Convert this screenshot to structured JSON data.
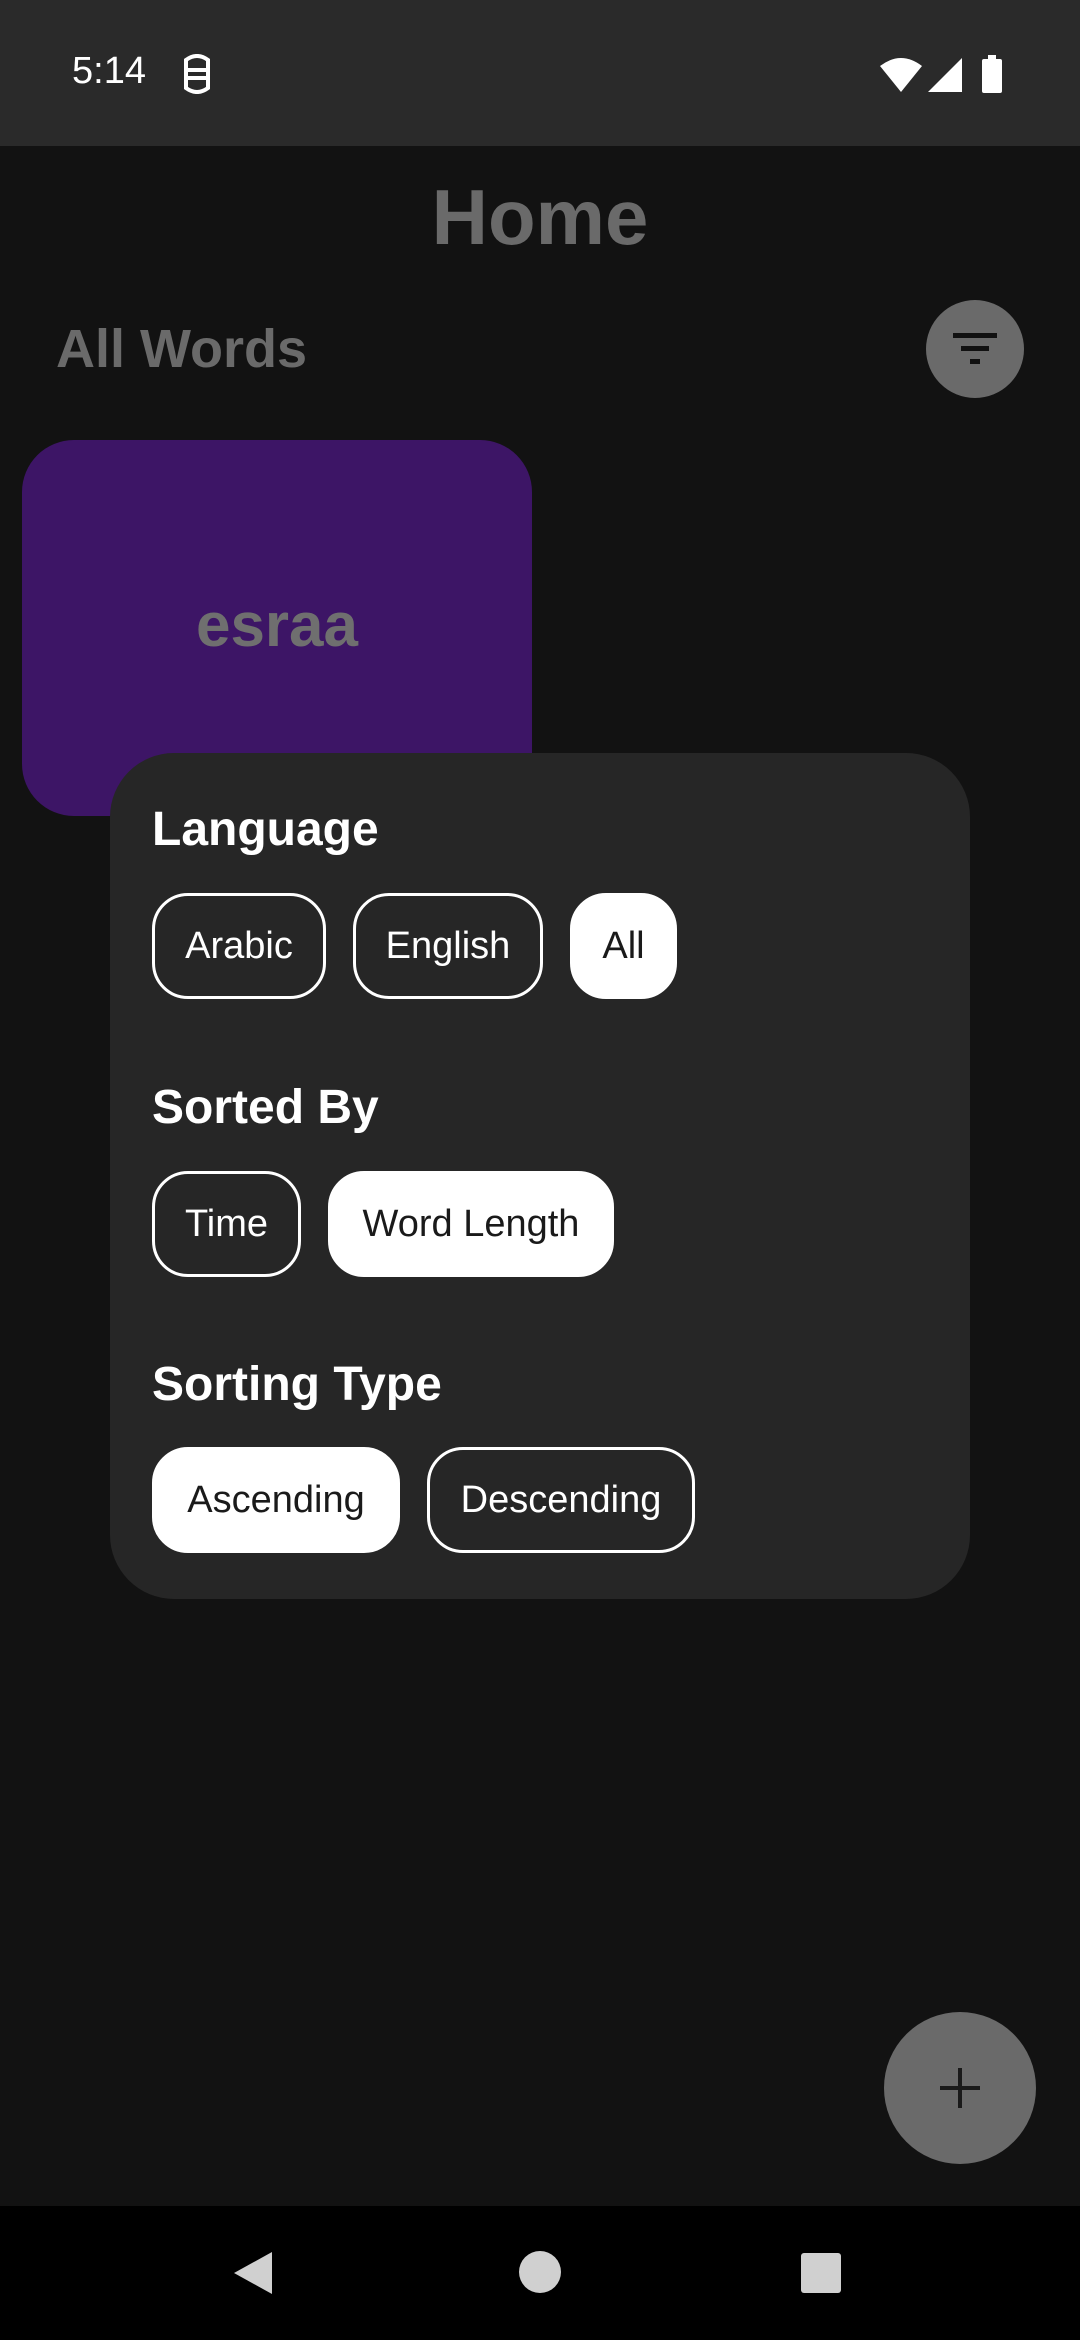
{
  "status_bar": {
    "time": "5:14",
    "icons": [
      "notification-icon",
      "wifi-icon",
      "signal-icon",
      "battery-icon"
    ]
  },
  "header": {
    "title": "Home"
  },
  "words_section": {
    "title": "All Words",
    "filter_icon": "filter-icon"
  },
  "word_cards": [
    {
      "word": "esraa",
      "color": "#3d1566"
    }
  ],
  "filter_sheet": {
    "language": {
      "heading": "Language",
      "options": [
        "Arabic",
        "English",
        "All"
      ],
      "selected": "All"
    },
    "sorted_by": {
      "heading": "Sorted By",
      "options": [
        "Time",
        "Word Length"
      ],
      "selected": "Word Length"
    },
    "sorting_type": {
      "heading": "Sorting Type",
      "options": [
        "Ascending",
        "Descending"
      ],
      "selected": "Ascending"
    }
  },
  "fab": {
    "icon": "plus-icon"
  },
  "nav_bar": {
    "icons": [
      "back-icon",
      "home-icon",
      "recents-icon"
    ]
  },
  "colors": {
    "background": "#121212",
    "sheet": "#262626",
    "card": "#3d1566",
    "muted": "#6a6a6a",
    "chip_selected": "#ffffff"
  }
}
